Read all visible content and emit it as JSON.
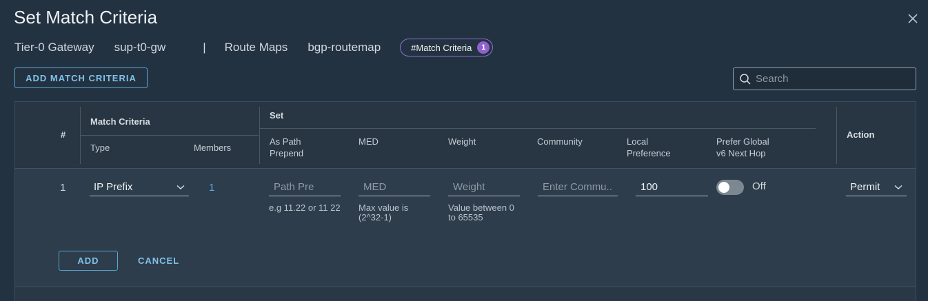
{
  "dialog": {
    "title": "Set Match Criteria",
    "breadcrumb": {
      "gateway_label": "Tier-0 Gateway",
      "gateway_value": "sup-t0-gw",
      "separator": "|",
      "route_maps_label": "Route Maps",
      "route_map_value": "bgp-routemap",
      "match_criteria_pill": "#Match Criteria",
      "match_criteria_count": "1"
    },
    "add_match_criteria_label": "ADD MATCH CRITERIA",
    "search": {
      "placeholder": "Search",
      "value": ""
    }
  },
  "table": {
    "headers": {
      "number": "#",
      "match_criteria": "Match Criteria",
      "type": "Type",
      "members": "Members",
      "set": "Set",
      "as_path_prepend": "As Path\nPrepend",
      "med": "MED",
      "weight": "Weight",
      "community": "Community",
      "local_preference": "Local\nPreference",
      "prefer_global_v6": "Prefer Global\nv6 Next Hop",
      "action": "Action"
    },
    "row": {
      "number": "1",
      "type_value": "IP Prefix",
      "members_count": "1",
      "as_path_placeholder": "Path Pre",
      "as_path_hint": "e.g 11.22 or 11 22",
      "med_placeholder": "MED",
      "med_hint": "Max value is\n(2^32-1)",
      "weight_placeholder": "Weight",
      "weight_hint": "Value between 0\nto 65535",
      "community_placeholder": "Enter Commu...",
      "local_preference_value": "100",
      "prefer_global_state": "Off",
      "prefer_global_on": false,
      "action_value": "Permit",
      "add_label": "ADD",
      "cancel_label": "CANCEL"
    }
  },
  "colors": {
    "background": "#233241",
    "accent": "#7fc1ea",
    "pill_border": "#8f6fd4",
    "badge": "#9160cf"
  }
}
